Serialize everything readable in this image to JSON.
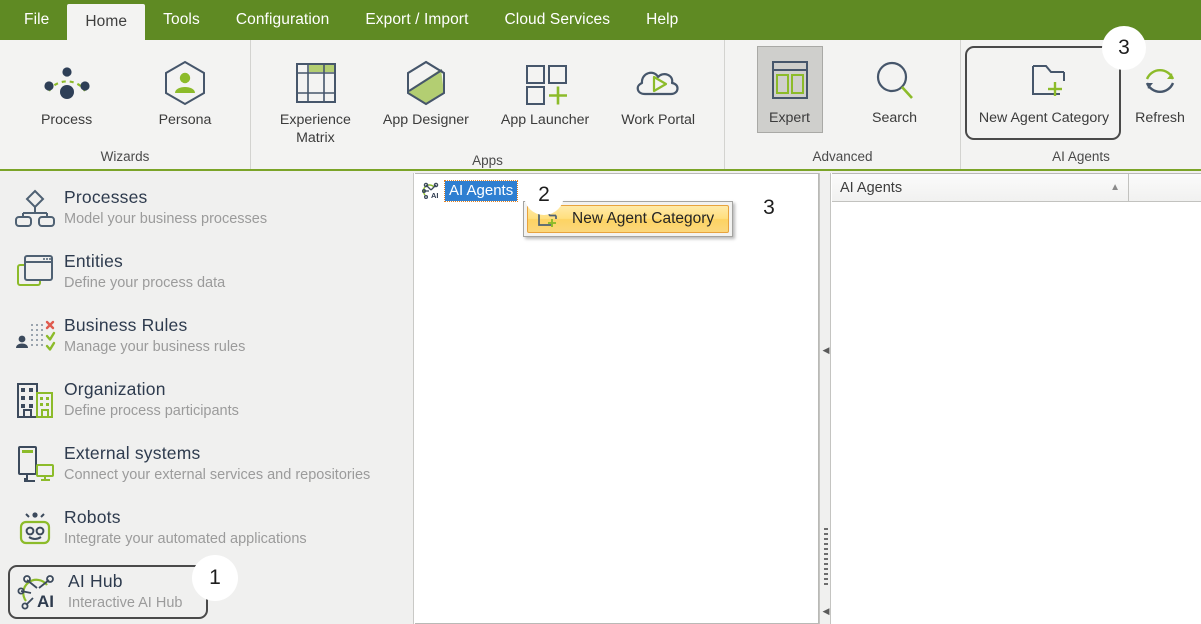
{
  "menubar": {
    "tabs": [
      {
        "label": "File",
        "active": false
      },
      {
        "label": "Home",
        "active": true
      },
      {
        "label": "Tools",
        "active": false
      },
      {
        "label": "Configuration",
        "active": false
      },
      {
        "label": "Export / Import",
        "active": false
      },
      {
        "label": "Cloud Services",
        "active": false
      },
      {
        "label": "Help",
        "active": false
      }
    ],
    "bg_color": "#5f8a23"
  },
  "ribbon": {
    "accent_color": "#7ba428",
    "groups": [
      {
        "label": "Wizards",
        "buttons": [
          {
            "label": "Process",
            "icon": "process-wizard-icon",
            "selected": false
          },
          {
            "label": "Persona",
            "icon": "persona-icon",
            "selected": false
          }
        ]
      },
      {
        "label": "Apps",
        "buttons": [
          {
            "label": "Experience\nMatrix",
            "icon": "experience-matrix-icon",
            "selected": false
          },
          {
            "label": "App Designer",
            "icon": "app-designer-icon",
            "selected": false
          },
          {
            "label": "App Launcher",
            "icon": "app-launcher-icon",
            "selected": false
          },
          {
            "label": "Work Portal",
            "icon": "work-portal-icon",
            "selected": false
          }
        ]
      },
      {
        "label": "Advanced",
        "buttons": [
          {
            "label": "Expert",
            "icon": "expert-icon",
            "selected": true
          },
          {
            "label": "Search",
            "icon": "search-icon",
            "selected": false
          }
        ]
      },
      {
        "label": "AI Agents",
        "buttons": [
          {
            "label": "New Agent Category",
            "icon": "new-agent-category-icon",
            "selected": false
          },
          {
            "label": "Refresh",
            "icon": "refresh-icon",
            "selected": false
          }
        ]
      }
    ]
  },
  "sidebar": {
    "items": [
      {
        "title": "Processes",
        "subtitle": "Model your business processes",
        "icon": "processes-icon"
      },
      {
        "title": "Entities",
        "subtitle": "Define your process data",
        "icon": "entities-icon"
      },
      {
        "title": "Business Rules",
        "subtitle": "Manage your business rules",
        "icon": "business-rules-icon"
      },
      {
        "title": "Organization",
        "subtitle": "Define process participants",
        "icon": "organization-icon"
      },
      {
        "title": "External systems",
        "subtitle": "Connect your external services and repositories",
        "icon": "external-systems-icon"
      },
      {
        "title": "Robots",
        "subtitle": "Integrate your automated applications",
        "icon": "robots-icon"
      },
      {
        "title": "AI Hub",
        "subtitle": "Interactive AI Hub",
        "icon": "ai-hub-icon"
      }
    ]
  },
  "tree": {
    "root_label": "AI Agents",
    "root_icon": "ai-agents-node-icon",
    "selected": true,
    "selection_color": "#2f7fd1"
  },
  "context_menu": {
    "items": [
      {
        "label": "New Agent Category",
        "icon": "new-agent-category-icon",
        "highlighted": true
      }
    ],
    "highlight_color": "#fbd763"
  },
  "grid": {
    "columns": [
      {
        "label": "AI Agents",
        "sort": "ascending",
        "sort_glyph": "▲"
      },
      {
        "label": "",
        "sort": "none",
        "sort_glyph": ""
      }
    ],
    "rows": []
  },
  "splitter": {
    "collapse_glyph": "◀"
  },
  "annotations": {
    "badges": [
      {
        "number": "1",
        "target": "ai-hub-sidebar-item"
      },
      {
        "number": "2",
        "target": "ai-agents-tree-node"
      },
      {
        "number": "3",
        "target": "new-agent-category-menu-item"
      },
      {
        "number": "3",
        "target": "new-agent-category-ribbon-button"
      }
    ]
  }
}
